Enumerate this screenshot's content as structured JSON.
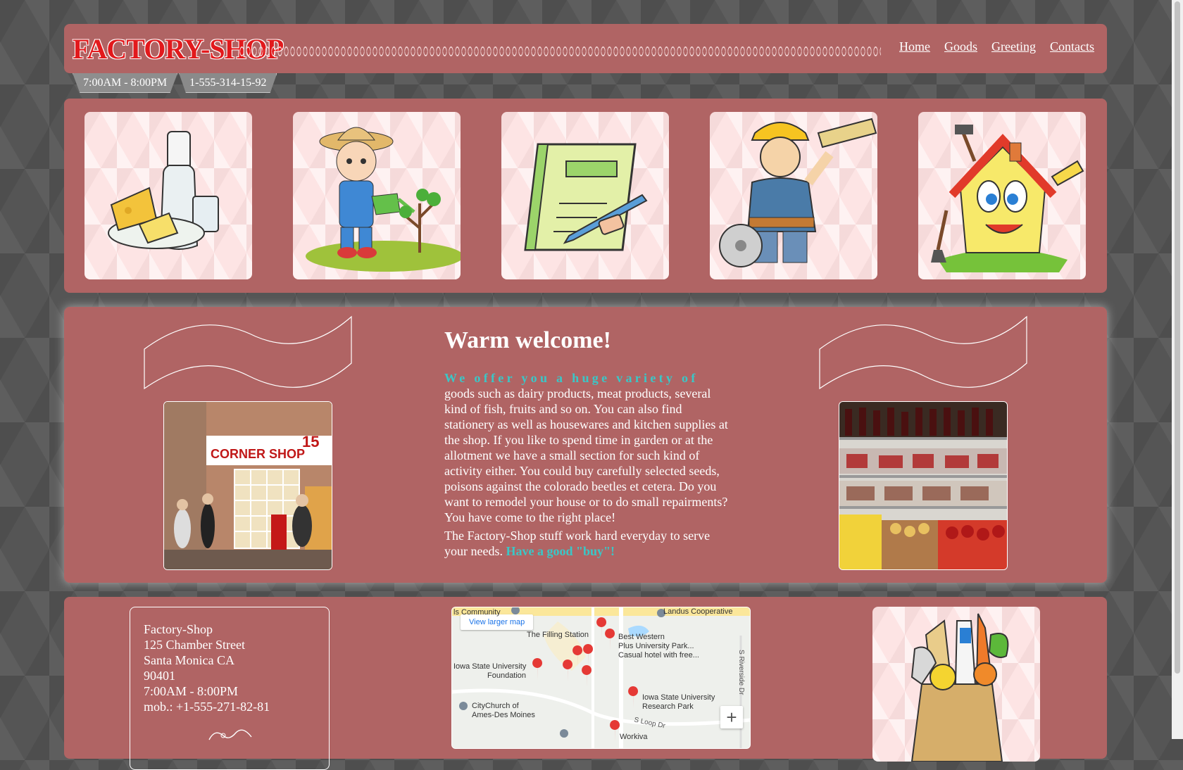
{
  "header": {
    "logo": "FACTORY-SHOP",
    "nav": [
      "Home",
      "Goods",
      "Greeting",
      "Contacts"
    ],
    "hours": "7:00AM - 8:00PM",
    "phone": "1-555-314-15-92"
  },
  "gallery": [
    {
      "name": "dairy-products-image"
    },
    {
      "name": "gardening-kid-image"
    },
    {
      "name": "stationery-notebook-image"
    },
    {
      "name": "builder-worker-image"
    },
    {
      "name": "house-repair-image"
    }
  ],
  "welcome": {
    "title": "Warm welcome!",
    "lead": "We offer you a huge variety of",
    "body": "goods such as dairy products, meat products, several kind of fish, fruits and so on. You can also find stationery as well as housewares and kitchen supplies at the shop. If you like to spend time in garden or at the allotment we have a small section for such kind of activity either. You could buy carefully selected seeds, poisons against the colorado beetles et cetera. Do you want to remodel your house or to do small repairments? You have come to the right place!",
    "closing": "The Factory-Shop stuff work hard everyday to serve your needs.",
    "closing_accent": "Have a good \"buy\"!",
    "left_photo_sign": "CORNER SHOP",
    "left_photo_number": "15"
  },
  "contact": {
    "lines": [
      "Factory-Shop",
      "125 Chamber Street",
      "Santa Monica CA",
      "90401",
      "7:00AM - 8:00PM",
      "mob.: +1-555-271-82-81"
    ]
  },
  "map": {
    "larger_link": "View larger map",
    "zoom_in": "+",
    "labels": {
      "landus": "Landus Cooperative",
      "filling": "The Filling Station",
      "best_western": "Best Western",
      "best_western2": "Plus University Park...",
      "hotel_desc": "Casual hotel with free...",
      "isu_foundation": "Iowa State University",
      "isu_foundation2": "Foundation",
      "research": "Iowa State University",
      "research2": "Research Park",
      "church": "CityChurch of",
      "church2": "Ames-Des Moines",
      "workiva": "Workiva",
      "community": "ls Community",
      "riverside": "S Riverside Dr",
      "loop": "S Loop Dr"
    }
  },
  "colors": {
    "panel": "#b06464",
    "accent": "#3ac7c7",
    "logo": "#e2191c"
  }
}
